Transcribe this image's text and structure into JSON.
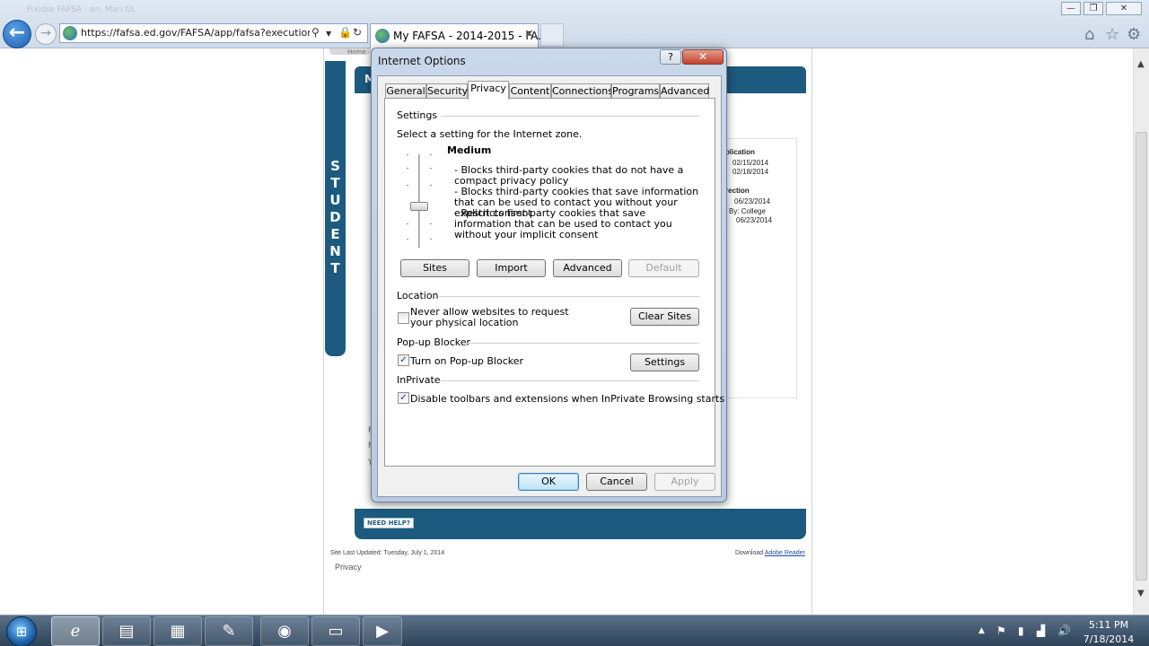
{
  "browser": {
    "address_url": "https://fafsa.ed.gov/FAFSA/app/fafsa?execution=e",
    "tab_title": "My FAFSA - 2014-2015 - FA...",
    "tab_close": "✕",
    "top_faded_text": "Fixidse   FAFSA - en, Mari t/L"
  },
  "page": {
    "student_letters": [
      "S",
      "T",
      "U",
      "D",
      "E",
      "N",
      "T"
    ],
    "header_initial": "M",
    "side_panel": [
      {
        "text": "plication",
        "bold": true
      },
      {
        "text": "02/15/2014",
        "bold": false
      },
      {
        "text": "02/18/2014",
        "bold": false
      },
      {
        "text": "rection",
        "bold": true
      },
      {
        "text": "06/23/2014",
        "bold": false
      },
      {
        "text": "By:  College",
        "bold": false
      },
      {
        "text": "06/23/2014",
        "bold": false
      }
    ],
    "need_help": "NEED HELP?",
    "site_last_updated": "Site Last Updated: Tuesday, July 1, 2014",
    "download_label": "Download",
    "adobe_link": "Adobe Reader",
    "privacy_link": "Privacy",
    "ghost_letters": [
      "F",
      "Fi",
      "Y"
    ]
  },
  "dialog": {
    "title": "Internet Options",
    "help_glyph": "?",
    "close_glyph": "✕",
    "tabs": [
      "General",
      "Security",
      "Privacy",
      "Content",
      "Connections",
      "Programs",
      "Advanced"
    ],
    "active_tab": "Privacy",
    "settings": {
      "group_label": "Settings",
      "instruction": "Select a setting for the Internet zone.",
      "level_name": "Medium",
      "descriptions": [
        "- Blocks third-party cookies that do not have a compact privacy policy",
        "- Blocks third-party cookies that save information that can be used to contact you without your explicit consent",
        "- Restricts first-party cookies that save information that can be used to contact you without your implicit consent"
      ],
      "buttons": {
        "sites": "Sites",
        "import": "Import",
        "advanced": "Advanced",
        "default": "Default"
      }
    },
    "location": {
      "group_label": "Location",
      "checkbox_label": "Never allow websites to request your physical location",
      "checked": false,
      "clear_sites": "Clear Sites"
    },
    "popup": {
      "group_label": "Pop-up Blocker",
      "checkbox_label": "Turn on Pop-up Blocker",
      "checked": true,
      "settings_button": "Settings"
    },
    "inprivate": {
      "group_label": "InPrivate",
      "checkbox_label": "Disable toolbars and extensions when InPrivate Browsing starts",
      "checked": true
    },
    "footer": {
      "ok": "OK",
      "cancel": "Cancel",
      "apply": "Apply"
    },
    "check_glyph": "✓"
  },
  "taskbar": {
    "time": "5:11 PM",
    "date": "7/18/2014"
  },
  "colors": {
    "fafsa_blue": "#1c5a7f",
    "close_red": "#c3432e",
    "taskbar": "#2d4258"
  }
}
